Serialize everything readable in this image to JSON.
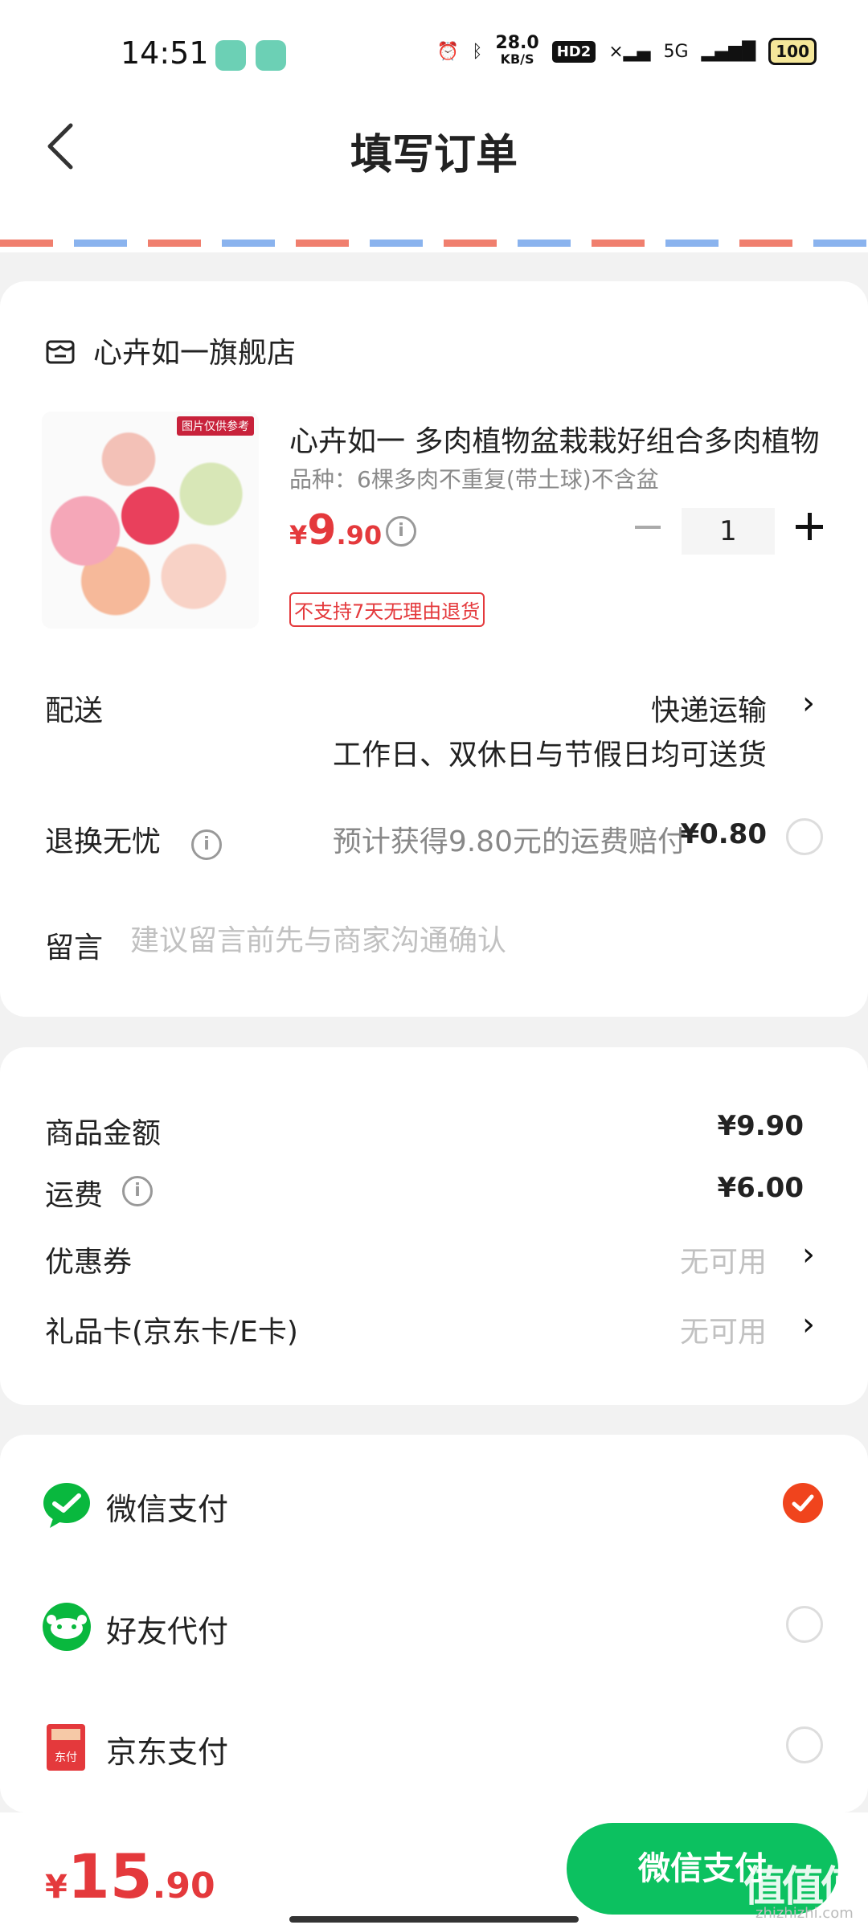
{
  "status_bar": {
    "time": "14:51",
    "net_speed_value": "28.0",
    "net_speed_unit": "KB/S",
    "hd_badge": "HD2",
    "network_type": "5G",
    "battery": "100"
  },
  "header": {
    "title": "填写订单"
  },
  "store": {
    "name": "心卉如一旗舰店"
  },
  "product": {
    "title": "心卉如一 多肉植物盆栽栽好组合多肉植物",
    "variant": "品种：6棵多肉不重复(带土球)不含盆",
    "price_currency": "¥",
    "price_int": "9",
    "price_dec": ".90",
    "image_badge": "图片仅供参考",
    "quantity": "1",
    "return_policy_tag": "不支持7天无理由退货"
  },
  "shipping": {
    "label": "配送",
    "method": "快递运输",
    "delivery_note": "工作日、双休日与节假日均可送货"
  },
  "return_worry": {
    "label": "退换无忧",
    "description": "预计获得9.80元的运费赔付",
    "price": "¥0.80"
  },
  "note": {
    "label": "留言",
    "placeholder": "建议留言前先与商家沟通确认"
  },
  "summary": {
    "goods_amount_label": "商品金额",
    "goods_amount_value": "¥9.90",
    "shipping_fee_label": "运费",
    "shipping_fee_value": "¥6.00",
    "coupon_label": "优惠券",
    "coupon_value": "无可用",
    "gift_card_label": "礼品卡(京东卡/E卡)",
    "gift_card_value": "无可用"
  },
  "payment": {
    "options": [
      {
        "label": "微信支付",
        "selected": true
      },
      {
        "label": "好友代付",
        "selected": false
      },
      {
        "label": "京东支付",
        "selected": false
      }
    ],
    "jd_icon_text": "东付"
  },
  "footer": {
    "total_currency": "¥",
    "total_int": "15",
    "total_dec": ".90",
    "pay_button_label": "微信支付",
    "watermark": "值值值",
    "watermark_url": "zhizhizhi.com"
  },
  "colors": {
    "accent_red": "#e4393c",
    "wechat_green": "#0cc160",
    "selected_orange": "#f0441d"
  }
}
